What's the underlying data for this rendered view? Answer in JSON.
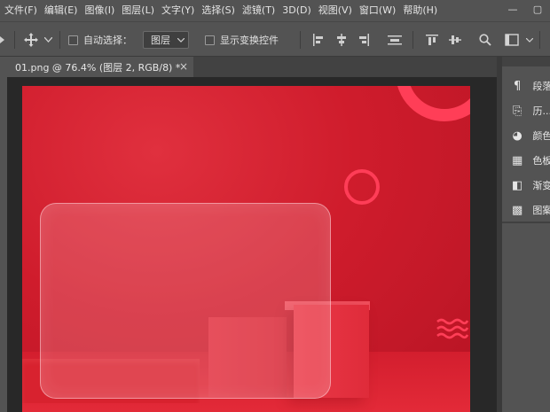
{
  "menu": {
    "items": [
      "文件(F)",
      "编辑(E)",
      "图像(I)",
      "图层(L)",
      "文字(Y)",
      "选择(S)",
      "滤镜(T)",
      "3D(D)",
      "视图(V)",
      "窗口(W)",
      "帮助(H)"
    ]
  },
  "window_controls": {
    "minimize": "—",
    "maximize": "▢"
  },
  "options_bar": {
    "auto_select_label": "自动选择：",
    "auto_select_checked": false,
    "layer_select_value": "图层",
    "show_transform_label": "显示变换控件",
    "show_transform_checked": false,
    "icons": [
      "move-tool-icon",
      "chevron-down-icon",
      "align-left-icon",
      "align-center-h-icon",
      "align-right-icon",
      "align-h-distribute-icon",
      "align-top-icon",
      "align-middle-v-icon",
      "search-icon",
      "workspace-icon",
      "chevron-down-icon"
    ]
  },
  "document": {
    "tab_title": "01.png @ 76.4% (图层 2, RGB/8) *",
    "close_glyph": "×"
  },
  "canvas": {
    "background_color": "#cf1c2c",
    "accent_color": "#ff3e57"
  },
  "panels": [
    {
      "icon": "paragraph-icon",
      "glyph": "¶",
      "label": "段落"
    },
    {
      "icon": "history-icon",
      "glyph": "⎘",
      "label": "历..."
    },
    {
      "icon": "color-palette-icon",
      "glyph": "◕",
      "label": "颜色"
    },
    {
      "icon": "swatches-icon",
      "glyph": "▦",
      "label": "色板"
    },
    {
      "icon": "gradient-icon",
      "glyph": "◧",
      "label": "渐变"
    },
    {
      "icon": "patterns-icon",
      "glyph": "▩",
      "label": "图案"
    }
  ]
}
